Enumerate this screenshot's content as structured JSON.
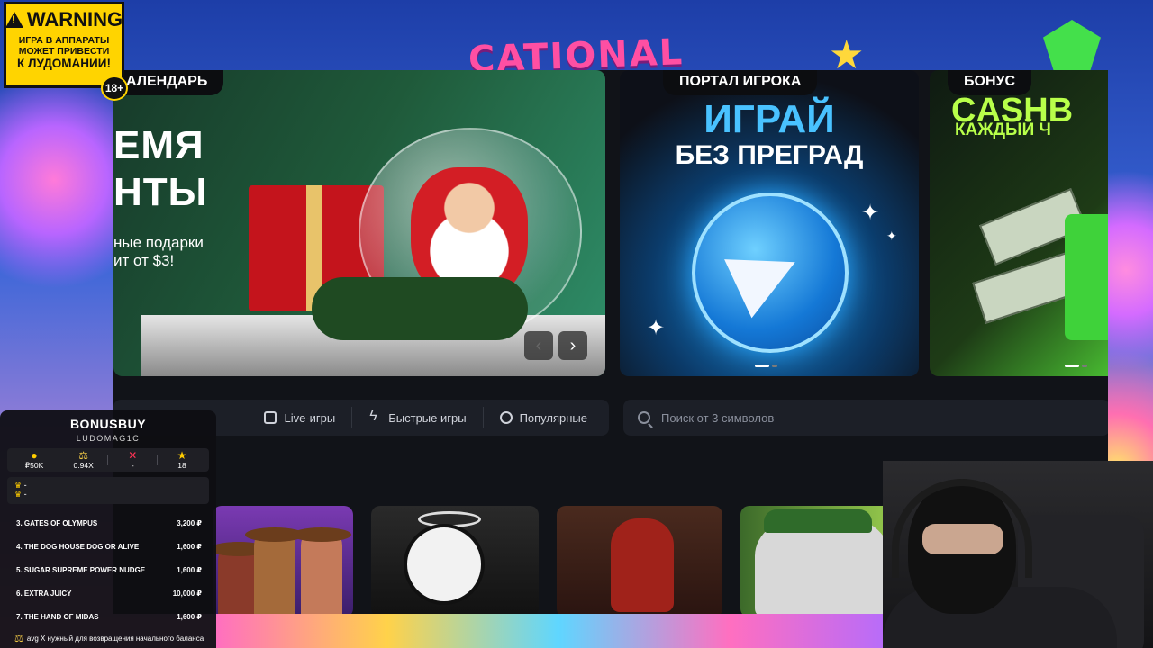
{
  "overlay": {
    "warning": {
      "title": "WARNING",
      "line1": "ИГРА В АППАРАТЫ",
      "line2": "МОЖЕТ ПРИВЕСТИ",
      "line3": "К ЛУДОМАНИИ!",
      "age": "18+"
    },
    "bonusbuy": {
      "title": "BONUSBUY",
      "subtitle": "LUDOMAG1C",
      "stats": [
        {
          "icon": "coin-icon",
          "value": "₽50K"
        },
        {
          "icon": "scale-icon",
          "value": "0.94X"
        },
        {
          "icon": "cross-icon",
          "value": "-"
        },
        {
          "icon": "star-icon",
          "value": "18"
        }
      ],
      "king_line1": "-",
      "king_line2": "-",
      "list": [
        {
          "name": "3. GATES OF OLYMPUS",
          "amount": "3,200 ₽"
        },
        {
          "name": "4. THE DOG HOUSE DOG OR ALIVE",
          "amount": "1,600 ₽"
        },
        {
          "name": "5. SUGAR SUPREME POWER NUDGE",
          "amount": "1,600 ₽"
        },
        {
          "name": "6. EXTRA JUICY",
          "amount": "10,000 ₽"
        },
        {
          "name": "7. THE HAND OF MIDAS",
          "amount": "1,600 ₽"
        }
      ],
      "footer": "avg X нужный для возвращения начального баланса"
    }
  },
  "site": {
    "banners": [
      {
        "tag": "АЛЕНДАРЬ",
        "big1": "ЕМЯ",
        "big2": "НТЫ",
        "small1": "ные подарки",
        "small2": "ит от $3!"
      },
      {
        "tag": "ПОРТАЛ ИГРОКА",
        "title": "ИГРАЙ",
        "subtitle": "БЕЗ ПРЕГРАД"
      },
      {
        "tag": "БОНУС",
        "title": "CASHB",
        "subtitle": "КАЖДЫЙ Ч"
      }
    ],
    "filters": [
      {
        "label": "Live-игры",
        "icon": "tv-icon"
      },
      {
        "label": "Быстрые игры",
        "icon": "lightning-icon"
      },
      {
        "label": "Популярные",
        "icon": "fire-icon"
      }
    ],
    "search_placeholder": "Поиск от 3 символов"
  }
}
